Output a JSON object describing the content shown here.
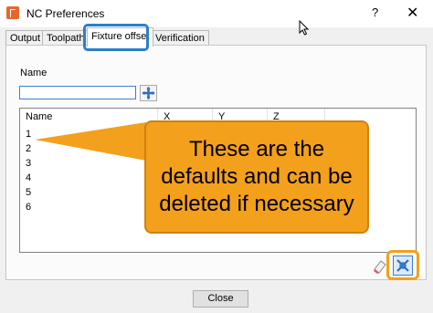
{
  "window": {
    "title": "NC Preferences",
    "help": "?",
    "close": "✕"
  },
  "tabs": [
    {
      "label": "Output"
    },
    {
      "label": "Toolpath"
    },
    {
      "label": "Fixture offset"
    },
    {
      "label": "Verification"
    }
  ],
  "form": {
    "name_label": "Name",
    "name_value": ""
  },
  "list": {
    "columns": [
      "Name",
      "X",
      "Y",
      "Z"
    ],
    "rows": [
      "1",
      "2",
      "3",
      "4",
      "5",
      "6"
    ]
  },
  "callout": {
    "text": "These are the defaults and can be deleted if necessary"
  },
  "footer": {
    "close_label": "Close"
  },
  "colors": {
    "highlight_blue": "#2b7fc8",
    "highlight_orange": "#f3a01c"
  }
}
